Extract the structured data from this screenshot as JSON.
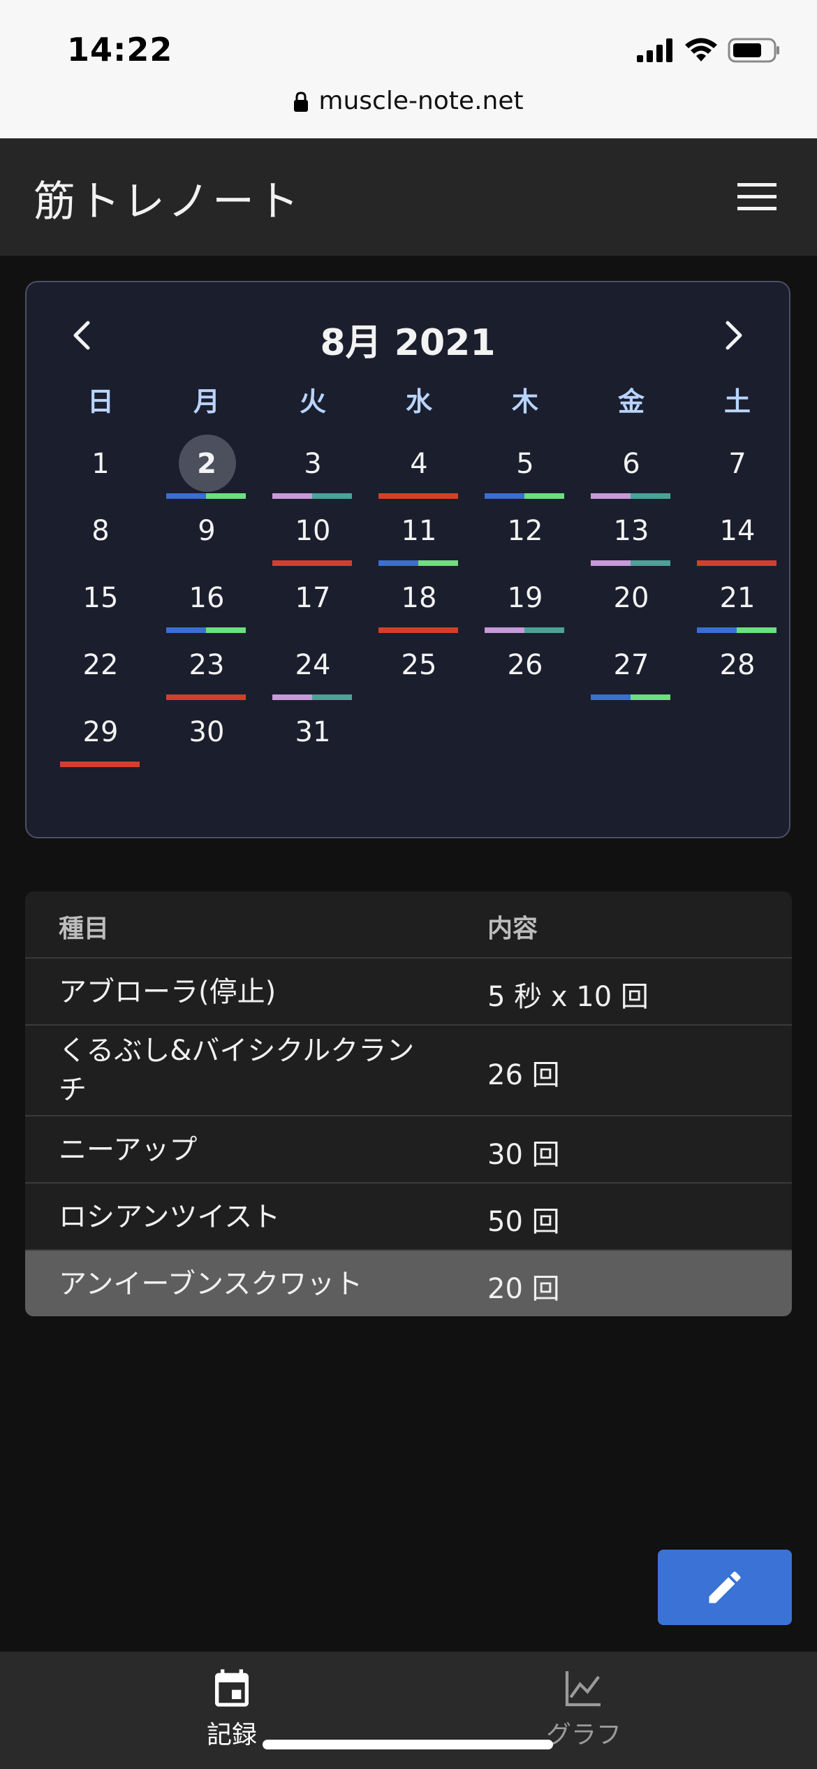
{
  "status_bar": {
    "time": "14:22",
    "url": "muscle-note.net"
  },
  "header": {
    "title": "筋トレノート",
    "menu_icon": "hamburger-menu-icon"
  },
  "calendar": {
    "title": "8月 2021",
    "selected_day": 2,
    "weekdays": [
      "日",
      "月",
      "火",
      "水",
      "木",
      "金",
      "土"
    ],
    "days": [
      "1",
      "2",
      "3",
      "4",
      "5",
      "6",
      "7",
      "8",
      "9",
      "10",
      "11",
      "12",
      "13",
      "14",
      "15",
      "16",
      "17",
      "18",
      "19",
      "20",
      "21",
      "22",
      "23",
      "24",
      "25",
      "26",
      "27",
      "28",
      "29",
      "30",
      "31"
    ],
    "start_weekday": 0,
    "marker_colors": {
      "blue": "#3b6fd0",
      "green": "#6be07f",
      "purple": "#c79ad9",
      "teal": "#4aa397",
      "red": "#d2402a"
    },
    "markers": {
      "2": [
        "blue",
        "green"
      ],
      "3": [
        "purple",
        "teal"
      ],
      "4": [
        "red"
      ],
      "5": [
        "blue",
        "green"
      ],
      "6": [
        "purple",
        "teal"
      ],
      "10": [
        "red"
      ],
      "11": [
        "blue",
        "green"
      ],
      "13": [
        "purple",
        "teal"
      ],
      "14": [
        "red"
      ],
      "16": [
        "blue",
        "green"
      ],
      "18": [
        "red"
      ],
      "19": [
        "purple",
        "teal"
      ],
      "21": [
        "blue",
        "green"
      ],
      "23": [
        "red"
      ],
      "24": [
        "purple",
        "teal"
      ],
      "27": [
        "blue",
        "green"
      ],
      "29": [
        "red"
      ]
    }
  },
  "records": {
    "headers": [
      "種目",
      "内容"
    ],
    "rows": [
      {
        "name": "アブローラ(停止)",
        "detail": "5 秒 x 10 回"
      },
      {
        "name": "くるぶし&バイシクルクランチ",
        "detail": "26 回"
      },
      {
        "name": "ニーアップ",
        "detail": "30 回"
      },
      {
        "name": "ロシアンツイスト",
        "detail": "50 回"
      },
      {
        "name": "アンイーブンスクワット",
        "detail": "20 回"
      }
    ]
  },
  "fab": {
    "icon": "pencil-edit-icon"
  },
  "bottom_nav": {
    "items": [
      {
        "label": "記録",
        "icon": "calendar-icon",
        "active": true
      },
      {
        "label": "グラフ",
        "icon": "line-chart-icon",
        "active": false
      }
    ]
  }
}
